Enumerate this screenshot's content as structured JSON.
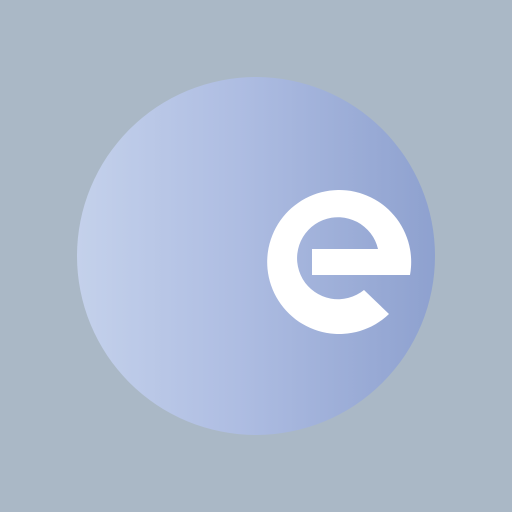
{
  "logo": {
    "letter": "e",
    "colors": {
      "background": "#aab8c6",
      "circle_gradient_start": "#c4d1eb",
      "circle_gradient_end": "#8ea1cf",
      "letter": "#ffffff"
    }
  }
}
